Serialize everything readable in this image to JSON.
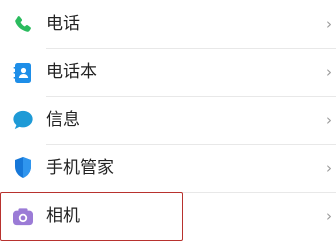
{
  "settings_list": {
    "items": [
      {
        "label": "电话",
        "icon": "phone-icon",
        "icon_color": "#2bbb5e"
      },
      {
        "label": "电话本",
        "icon": "contacts-book-icon",
        "icon_color": "#1e8ee8"
      },
      {
        "label": "信息",
        "icon": "message-bubble-icon",
        "icon_color": "#1e9ad6"
      },
      {
        "label": "手机管家",
        "icon": "shield-icon",
        "icon_color": "#1677d8"
      },
      {
        "label": "相机",
        "icon": "camera-icon",
        "icon_color": "#9b7bd6"
      }
    ],
    "chevron": "›"
  },
  "highlight_color": "#b8322e"
}
